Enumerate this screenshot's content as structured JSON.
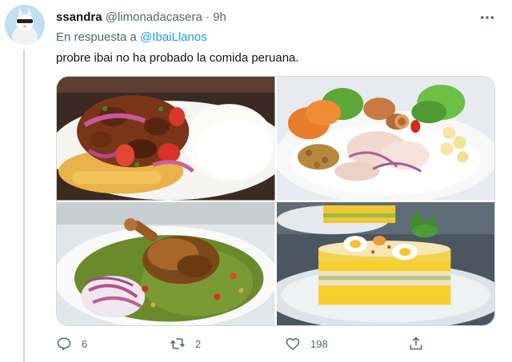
{
  "tweet": {
    "display_name": "ssandra",
    "handle": "@limonadacasera",
    "separator": "·",
    "time": "9h",
    "reply_prefix": "En respuesta a",
    "reply_mention": "@IbaiLlanos",
    "text": "probre ibai no ha probado la comida peruana."
  },
  "media": {
    "images": [
      {
        "icon": "food-photo-lomo-saltado"
      },
      {
        "icon": "food-photo-ceviche"
      },
      {
        "icon": "food-photo-arroz-con-pollo"
      },
      {
        "icon": "food-photo-causa"
      }
    ]
  },
  "actions": {
    "reply_count": "6",
    "retweet_count": "2",
    "like_count": "198"
  },
  "colors": {
    "text_primary": "#0f1419",
    "text_secondary": "#536471",
    "accent_blue": "#1d9bf0",
    "border": "#cfd9de"
  }
}
